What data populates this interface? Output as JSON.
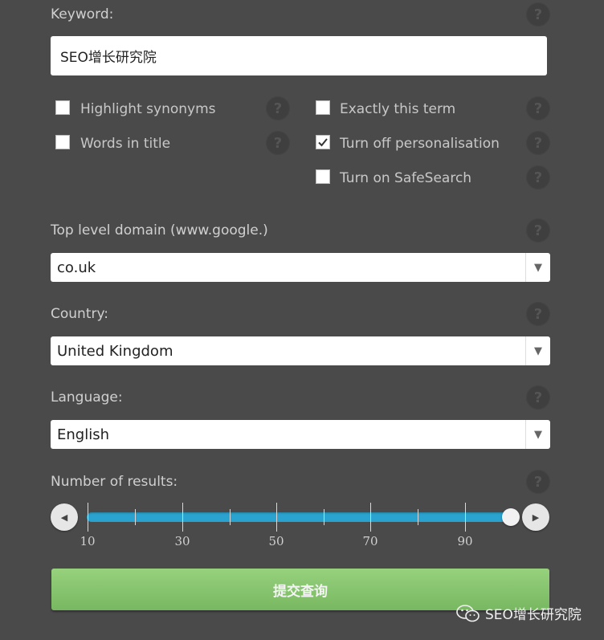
{
  "keyword": {
    "label": "Keyword:",
    "value": "SEO增长研究院"
  },
  "options": {
    "highlight_synonyms": {
      "label": "Highlight synonyms",
      "checked": false
    },
    "words_in_title": {
      "label": "Words in title",
      "checked": false
    },
    "exactly_this_term": {
      "label": "Exactly this term",
      "checked": false
    },
    "turn_off_personalisation": {
      "label": "Turn off personalisation",
      "checked": true
    },
    "turn_on_safesearch": {
      "label": "Turn on SafeSearch",
      "checked": false
    }
  },
  "tld": {
    "label": "Top level domain (www.google.)",
    "value": "co.uk"
  },
  "country": {
    "label": "Country:",
    "value": "United Kingdom"
  },
  "language": {
    "label": "Language:",
    "value": "English"
  },
  "results": {
    "label": "Number of results:",
    "value": 100,
    "ticks": [
      "10",
      "30",
      "50",
      "70",
      "90"
    ]
  },
  "help_glyph": "?",
  "submit_label": "提交查询",
  "watermark": "SEO增长研究院",
  "colors": {
    "background": "#4a4a4a",
    "slider": "#2ba3d0",
    "submit": "#86c46d"
  }
}
